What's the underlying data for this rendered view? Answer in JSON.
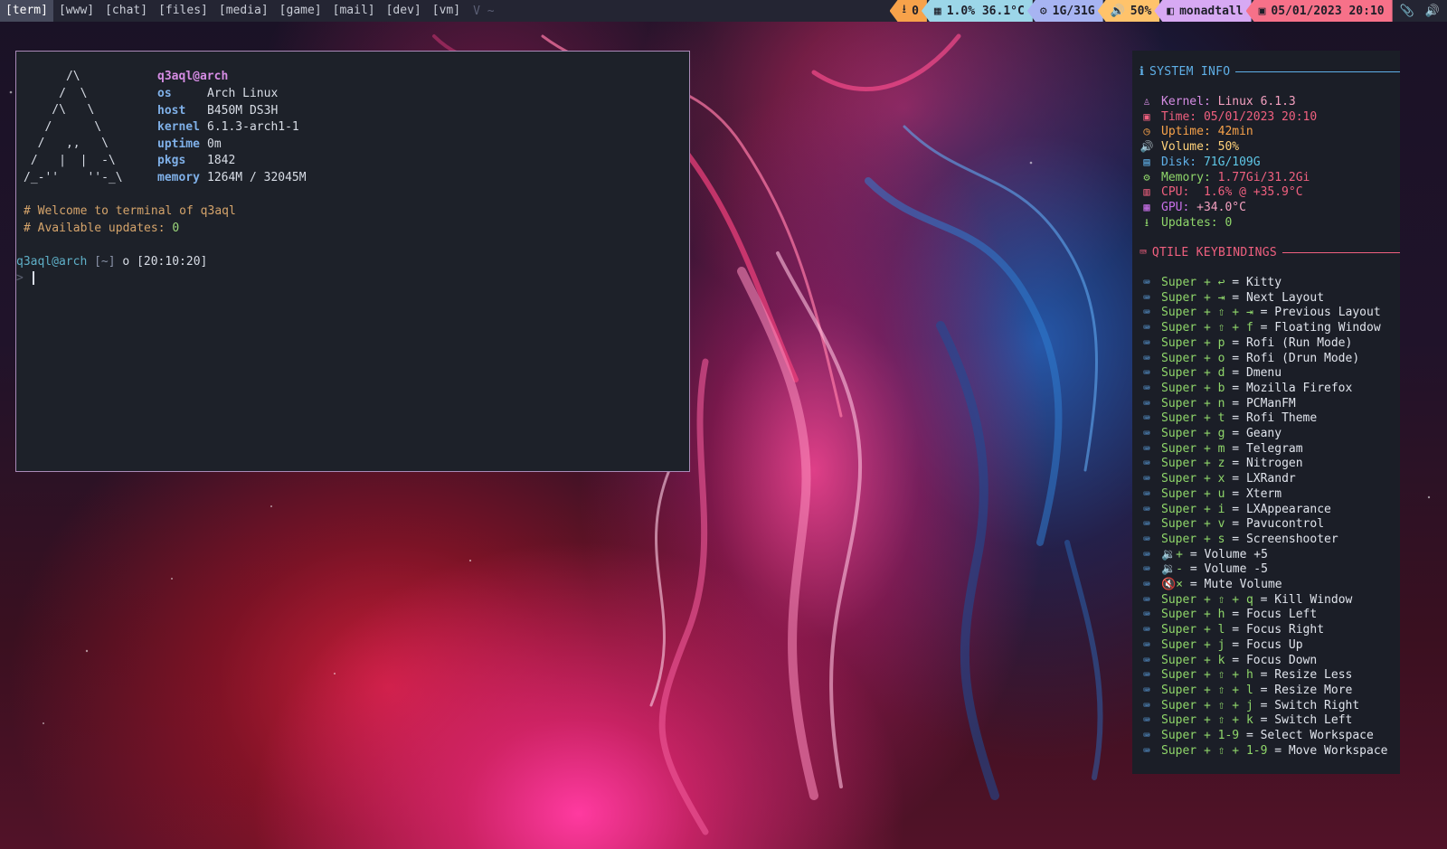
{
  "colors": {
    "accent_blue": "#5fb0e8",
    "accent_green": "#8fd66a",
    "accent_pink": "#d58ce3",
    "bar_bg": "#242533",
    "terminal_bg": "#1d2129",
    "conky_bg": "#1b1e27"
  },
  "bar": {
    "workspaces": [
      {
        "label": "[term]",
        "active": true
      },
      {
        "label": "[www]",
        "active": false
      },
      {
        "label": "[chat]",
        "active": false
      },
      {
        "label": "[files]",
        "active": false
      },
      {
        "label": "[media]",
        "active": false
      },
      {
        "label": "[game]",
        "active": false
      },
      {
        "label": "[mail]",
        "active": false
      },
      {
        "label": "[dev]",
        "active": false
      },
      {
        "label": "[vm]",
        "active": false
      }
    ],
    "extra": "V ~",
    "widgets": {
      "updates": {
        "icon": "download-icon",
        "value": "0"
      },
      "cpu": {
        "icon": "cpu-icon",
        "value": "1.0%  36.1°C"
      },
      "memory": {
        "icon": "memory-chip-icon",
        "value": "1G/31G"
      },
      "volume": {
        "icon": "volume-icon",
        "value": "50%"
      },
      "layout": {
        "icon": "layout-icon",
        "value": "monadtall"
      },
      "clock": {
        "icon": "calendar-icon",
        "value": "05/01/2023 20:10"
      },
      "tray": [
        "paperclip-icon",
        "speaker-icon"
      ]
    }
  },
  "terminal": {
    "ascii_art": [
      "      /\\",
      "     /  \\",
      "    /\\   \\",
      "   /      \\",
      "  /   ,,   \\",
      " /   |  |  -\\",
      "/_-''    ''-_\\"
    ],
    "user_host": "q3aql@arch",
    "info": [
      {
        "key": "os",
        "value": "Arch Linux"
      },
      {
        "key": "host",
        "value": "B450M DS3H"
      },
      {
        "key": "kernel",
        "value": "6.1.3-arch1-1"
      },
      {
        "key": "uptime",
        "value": "0m"
      },
      {
        "key": "pkgs",
        "value": "1842"
      },
      {
        "key": "memory",
        "value": "1264M / 32045M"
      }
    ],
    "welcome": "# Welcome to terminal of q3aql",
    "updates_label": "# Available updates:",
    "updates_value": "0",
    "prompt": {
      "user": "q3aql@arch",
      "dir": "[~]",
      "o": "o",
      "time": "[20:10:20]",
      "arrow": ">"
    }
  },
  "conky": {
    "system_title": "SYSTEM INFO",
    "system": [
      {
        "icon": "linux-icon",
        "color": "#d58ce3",
        "label": "Kernel: ",
        "value": "Linux 6.1.3",
        "vcolor": "#f4a0c0"
      },
      {
        "icon": "calendar-icon",
        "color": "#f0607f",
        "label": "Time: ",
        "value": "05/01/2023 20:10",
        "vcolor": "#f0607f"
      },
      {
        "icon": "clock-icon",
        "color": "#f7a24a",
        "label": "Uptime: ",
        "value": "42min",
        "vcolor": "#f7a24a"
      },
      {
        "icon": "volume-icon",
        "color": "#ffd27a",
        "label": "Volume: ",
        "value": "50%",
        "vcolor": "#ffd27a"
      },
      {
        "icon": "disk-icon",
        "color": "#5fb0e8",
        "label": "Disk: ",
        "value": "71G/109G",
        "vcolor": "#5fc8e8"
      },
      {
        "icon": "memory-chip-icon",
        "color": "#8fd66a",
        "label": "Memory: ",
        "value": "1.77Gi/31.2Gi",
        "vcolor": "#f0607f"
      },
      {
        "icon": "cpu-icon",
        "color": "#f0607f",
        "label": "CPU: ",
        "value": " 1.6% @ +35.9°C",
        "vcolor": "#f0607f"
      },
      {
        "icon": "gpu-icon",
        "color": "#c870e8",
        "label": "GPU: ",
        "value": "+34.0°C",
        "vcolor": "#f4a0c0"
      },
      {
        "icon": "download-icon",
        "color": "#8fd66a",
        "label": "Updates: ",
        "value": "0",
        "vcolor": "#8fd66a"
      }
    ],
    "keys_title": "QTILE KEYBINDINGS",
    "keys": [
      {
        "combo": [
          "Super",
          "+",
          "↩"
        ],
        "action": "Kitty"
      },
      {
        "combo": [
          "Super",
          "+",
          "⇥"
        ],
        "action": "Next Layout"
      },
      {
        "combo": [
          "Super",
          "+",
          "⇧",
          "+",
          "⇥"
        ],
        "action": "Previous Layout"
      },
      {
        "combo": [
          "Super",
          "+",
          "⇧",
          "+",
          "f"
        ],
        "action": "Floating Window"
      },
      {
        "combo": [
          "Super",
          "+",
          "p"
        ],
        "action": "Rofi (Run Mode)"
      },
      {
        "combo": [
          "Super",
          "+",
          "o"
        ],
        "action": "Rofi (Drun Mode)"
      },
      {
        "combo": [
          "Super",
          "+",
          "d"
        ],
        "action": "Dmenu"
      },
      {
        "combo": [
          "Super",
          "+",
          "b"
        ],
        "action": "Mozilla Firefox"
      },
      {
        "combo": [
          "Super",
          "+",
          "n"
        ],
        "action": "PCManFM"
      },
      {
        "combo": [
          "Super",
          "+",
          "t"
        ],
        "action": "Rofi Theme"
      },
      {
        "combo": [
          "Super",
          "+",
          "g"
        ],
        "action": "Geany"
      },
      {
        "combo": [
          "Super",
          "+",
          "m"
        ],
        "action": "Telegram"
      },
      {
        "combo": [
          "Super",
          "+",
          "z"
        ],
        "action": "Nitrogen"
      },
      {
        "combo": [
          "Super",
          "+",
          "x"
        ],
        "action": "LXRandr"
      },
      {
        "combo": [
          "Super",
          "+",
          "u"
        ],
        "action": "Xterm"
      },
      {
        "combo": [
          "Super",
          "+",
          "i"
        ],
        "action": "LXAppearance"
      },
      {
        "combo": [
          "Super",
          "+",
          "v"
        ],
        "action": "Pavucontrol"
      },
      {
        "combo": [
          "Super",
          "+",
          "s"
        ],
        "action": "Screenshooter"
      },
      {
        "combo": [
          "🔉+"
        ],
        "action": "Volume +5"
      },
      {
        "combo": [
          "🔉-"
        ],
        "action": "Volume -5"
      },
      {
        "combo": [
          "🔇×"
        ],
        "action": "Mute Volume"
      },
      {
        "combo": [
          "Super",
          "+",
          "⇧",
          "+",
          "q"
        ],
        "action": "Kill Window"
      },
      {
        "combo": [
          "Super",
          "+",
          "h"
        ],
        "action": "Focus Left"
      },
      {
        "combo": [
          "Super",
          "+",
          "l"
        ],
        "action": "Focus Right"
      },
      {
        "combo": [
          "Super",
          "+",
          "j"
        ],
        "action": "Focus Up"
      },
      {
        "combo": [
          "Super",
          "+",
          "k"
        ],
        "action": "Focus Down"
      },
      {
        "combo": [
          "Super",
          "+",
          "⇧",
          "+",
          "h"
        ],
        "action": "Resize Less"
      },
      {
        "combo": [
          "Super",
          "+",
          "⇧",
          "+",
          "l"
        ],
        "action": "Resize More"
      },
      {
        "combo": [
          "Super",
          "+",
          "⇧",
          "+",
          "j"
        ],
        "action": "Switch Right"
      },
      {
        "combo": [
          "Super",
          "+",
          "⇧",
          "+",
          "k"
        ],
        "action": "Switch Left"
      },
      {
        "combo": [
          "Super",
          "+",
          "1-9"
        ],
        "action": "Select Workspace"
      },
      {
        "combo": [
          "Super",
          "+",
          "⇧",
          "+",
          "1-9"
        ],
        "action": "Move Workspace"
      }
    ]
  }
}
